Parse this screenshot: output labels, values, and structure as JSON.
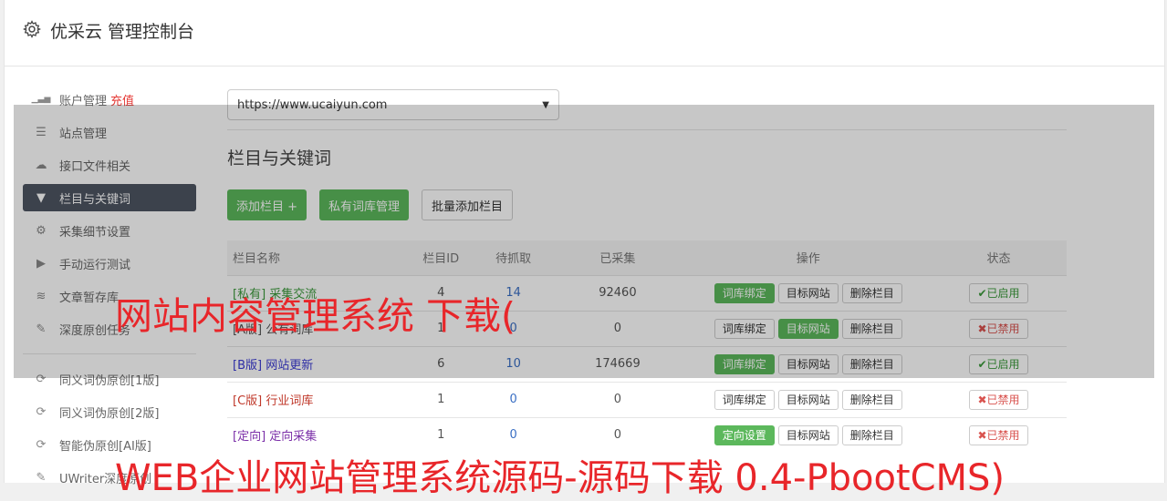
{
  "header": {
    "title": "优采云 管理控制台"
  },
  "sidebar": {
    "items": [
      {
        "label": "账户管理",
        "extra": "充值",
        "icon": "bar-chart-icon"
      },
      {
        "label": "站点管理",
        "icon": "server-icon"
      },
      {
        "label": "接口文件相关",
        "icon": "cloud-upload-icon"
      },
      {
        "label": "栏目与关键词",
        "icon": "filter-icon",
        "active": true
      },
      {
        "label": "采集细节设置",
        "icon": "cogs-icon"
      },
      {
        "label": "手动运行测试",
        "icon": "play-circle-icon"
      },
      {
        "label": "文章暂存库",
        "icon": "database-icon"
      },
      {
        "label": "深度原创任务",
        "icon": "edit-icon"
      }
    ],
    "items2": [
      {
        "label": "同义词伪原创[1版]",
        "icon": "refresh-icon"
      },
      {
        "label": "同义词伪原创[2版]",
        "icon": "refresh-icon"
      },
      {
        "label": "智能伪原创[AI版]",
        "icon": "refresh-icon"
      },
      {
        "label": "UWriter深度原创",
        "icon": "edit-icon"
      }
    ]
  },
  "main": {
    "site_select": "https://www.ucaiyun.com",
    "section_title": "栏目与关键词",
    "buttons": {
      "add_column": "添加栏目 +",
      "private_lexicon": "私有词库管理",
      "batch_add": "批量添加栏目"
    },
    "table": {
      "headers": [
        "栏目名称",
        "栏目ID",
        "待抓取",
        "已采集",
        "操作",
        "状态"
      ],
      "rows": [
        {
          "tag": "[私有]",
          "name": "采集交流",
          "id": "4",
          "pending": "14",
          "collected": "92460",
          "op1": "词库绑定",
          "op1_green": true,
          "op2": "目标网站",
          "op2_green": false,
          "op3": "删除栏目",
          "status": "✔已启用",
          "on": true,
          "tag_color": "#3c9a3c"
        },
        {
          "tag": "[A版]",
          "name": "公有词库",
          "id": "1",
          "pending": "0",
          "collected": "0",
          "op1": "词库绑定",
          "op1_green": false,
          "op2": "目标网站",
          "op2_green": true,
          "op3": "删除栏目",
          "status": "✖已禁用",
          "on": false,
          "tag_color": "#555555"
        },
        {
          "tag": "[B版]",
          "name": "网站更新",
          "id": "6",
          "pending": "10",
          "collected": "174669",
          "op1": "词库绑定",
          "op1_green": true,
          "op2": "目标网站",
          "op2_green": false,
          "op3": "删除栏目",
          "status": "✔已启用",
          "on": true,
          "tag_color": "#3a3ad4"
        },
        {
          "tag": "[C版]",
          "name": "行业词库",
          "id": "1",
          "pending": "0",
          "collected": "0",
          "op1": "词库绑定",
          "op1_green": false,
          "op2": "目标网站",
          "op2_green": false,
          "op3": "删除栏目",
          "status": "✖已禁用",
          "on": false,
          "tag_color": "#c0392b"
        },
        {
          "tag": "[定向]",
          "name": "定向采集",
          "id": "1",
          "pending": "0",
          "collected": "0",
          "op1": "定向设置",
          "op1_green": true,
          "op2": "目标网站",
          "op2_green": false,
          "op3": "删除栏目",
          "status": "✖已禁用",
          "on": false,
          "tag_color": "#7b2fa8"
        }
      ]
    }
  },
  "watermarks": {
    "line1": "网站内容管理系统 下载(",
    "line2": "WEB企业网站管理系统源码-源码下载 0.4-PbootCMS)"
  }
}
